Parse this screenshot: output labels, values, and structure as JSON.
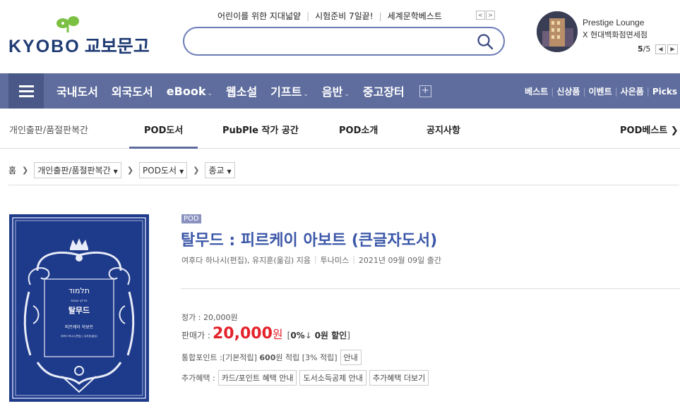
{
  "header": {
    "logo_text": "KYOBO",
    "logo_korean": "교보문고",
    "quick_links": [
      "어린이를 위한 지대넓얕",
      "시험준비 7일끝!",
      "세계문학베스트"
    ],
    "search_placeholder": "",
    "promo": {
      "title": "Prestige Lounge",
      "subtitle": "X 현대백화점면세점",
      "page_current": "5",
      "page_total": "/5"
    }
  },
  "main_nav": {
    "items": [
      "국내도서",
      "외국도서",
      "eBook",
      "웹소설",
      "기프트",
      "음반",
      "중고장터"
    ],
    "chevrons": [
      false,
      false,
      true,
      false,
      true,
      true,
      false
    ],
    "right_links": [
      "베스트",
      "신상품",
      "이벤트",
      "사은품",
      "Picks"
    ]
  },
  "sub_nav": {
    "category": "개인출판/품절판복간",
    "tabs": [
      "POD도서",
      "PubPle 작가 공간",
      "POD소개",
      "공지사항"
    ],
    "active_tab": "POD도서",
    "right_tab": "POD베스트"
  },
  "breadcrumb": {
    "home": "홈",
    "levels": [
      "개인출판/품절판복간",
      "POD도서",
      "종교"
    ]
  },
  "product": {
    "badge": "POD",
    "title": "탈무드 : 피르케이 아보트 (큰글자도서)",
    "authors": "여후다 하나시(편집), 유지훈(옮김) 지음",
    "publisher": "투나미스",
    "pub_date": "2021년 09월 09일 출간",
    "list_price_label": "정가 : ",
    "list_price": "20,000원",
    "sale_label": "판매가 : ",
    "sale_price": "20,000",
    "sale_unit": "원",
    "discount_pct": "0%",
    "discount_amount": "0원 할인",
    "points_label": "통합포인트 : ",
    "points_basic": "[기본적립]",
    "points_value": "600",
    "points_unit": "원 적립",
    "points_rate": "[3% 적립]",
    "points_info_button": "안내",
    "benefits_label": "추가혜택 : ",
    "benefits_buttons": [
      "카드/포인트 혜택 안내",
      "도서소득공제 안내",
      "추가혜택 더보기"
    ],
    "cover": {
      "hebrew_title": "תלמוד",
      "hebrew_sub": "פרקי אבות",
      "korean_title": "탈무드",
      "subtitle": "피르케이 아보트",
      "byline": "여후다 하나시(편집) | 유지훈(옮김)"
    }
  },
  "colors": {
    "nav_bg": "#5f6d9e",
    "accent_blue": "#3b57a8",
    "price_red": "#e4222b",
    "cover_blue": "#1e3a8a"
  }
}
